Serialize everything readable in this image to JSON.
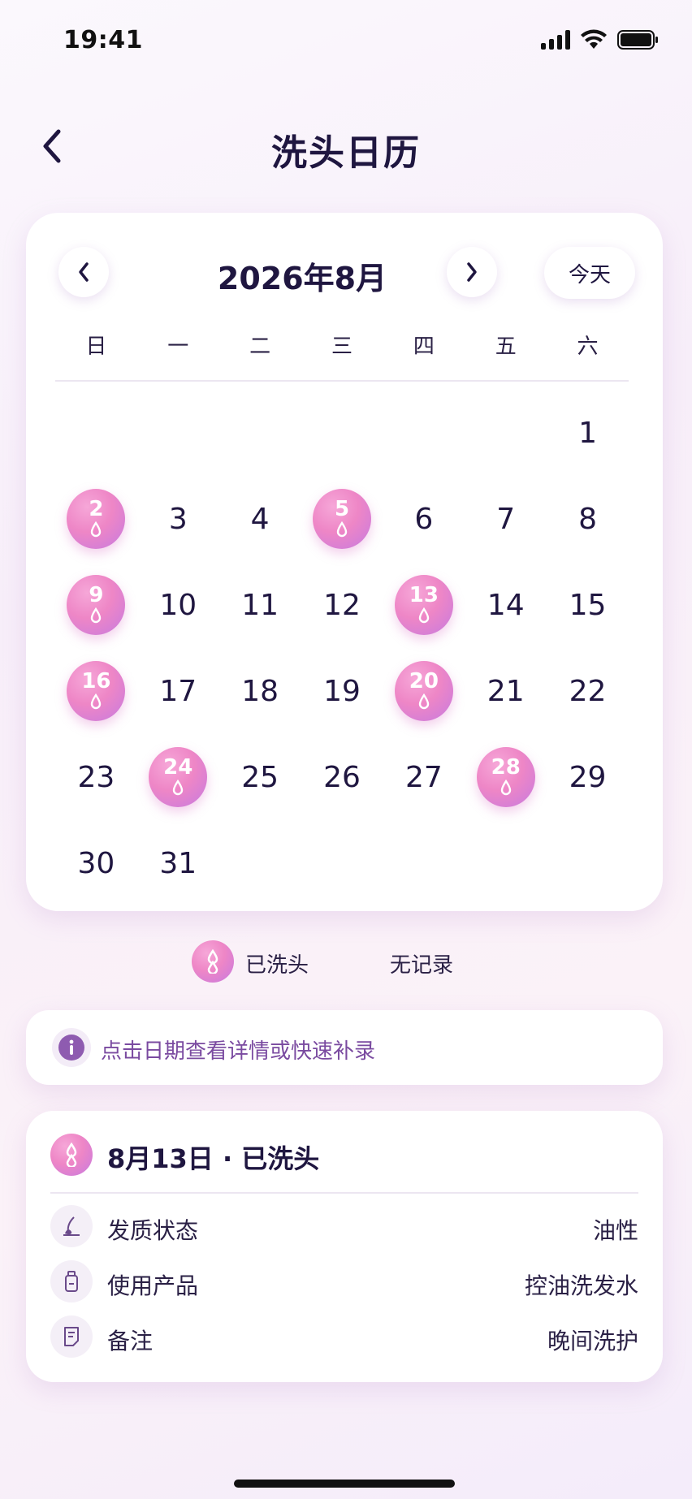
{
  "status_bar": {
    "time": "19:41"
  },
  "nav": {
    "title": "洗头日历"
  },
  "calendar": {
    "month_label": "2026年8月",
    "today_label": "今天",
    "weekdays": [
      "日",
      "一",
      "二",
      "三",
      "四",
      "五",
      "六"
    ],
    "leading_blanks": 6,
    "days": [
      "1",
      "2",
      "3",
      "4",
      "5",
      "6",
      "7",
      "8",
      "9",
      "10",
      "11",
      "12",
      "13",
      "14",
      "15",
      "16",
      "17",
      "18",
      "19",
      "20",
      "21",
      "22",
      "23",
      "24",
      "25",
      "26",
      "27",
      "28",
      "29",
      "30",
      "31"
    ],
    "washed_days": [
      2,
      5,
      9,
      13,
      16,
      20,
      24,
      28
    ]
  },
  "legend": {
    "washed_label": "已洗头",
    "none_label": "无记录"
  },
  "tip": {
    "text": "点击日期查看详情或快速补录"
  },
  "detail": {
    "title": "8月13日 · 已洗头",
    "rows": [
      {
        "icon": "brush-icon",
        "label": "发质状态",
        "value": "油性"
      },
      {
        "icon": "bottle-icon",
        "label": "使用产品",
        "value": "控油洗发水"
      },
      {
        "icon": "note-icon",
        "label": "备注",
        "value": "晚间洗护"
      }
    ]
  },
  "colors": {
    "accent": "#ee86c6",
    "accent_purple": "#c67ae0",
    "text": "#1f1640",
    "tip_text": "#7a4aa0"
  }
}
